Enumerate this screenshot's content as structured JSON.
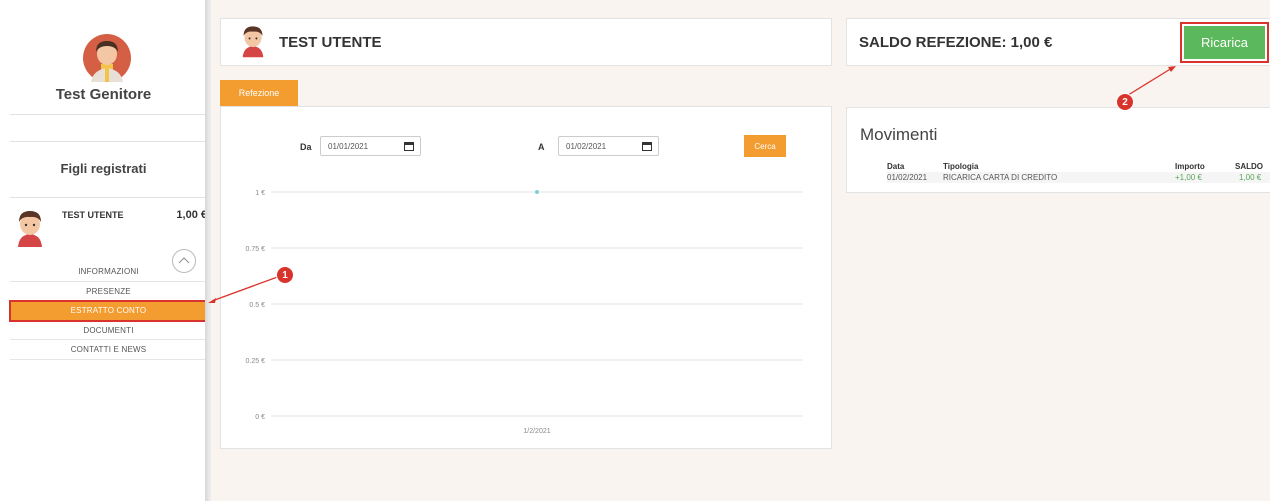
{
  "sidebar": {
    "parent_name": "Test Genitore",
    "children_title": "Figli registrati",
    "child": {
      "name": "TEST UTENTE",
      "balance": "1,00 €"
    },
    "menu": [
      {
        "label": "INFORMAZIONI",
        "active": false
      },
      {
        "label": "PRESENZE",
        "active": false
      },
      {
        "label": "ESTRATTO CONTO",
        "active": true
      },
      {
        "label": "DOCUMENTI",
        "active": false
      },
      {
        "label": "CONTATTI E NEWS",
        "active": false
      }
    ]
  },
  "header": {
    "user_title": "TEST UTENTE",
    "saldo_title": "SALDO REFEZIONE: 1,00 €",
    "ricarica_label": "Ricarica"
  },
  "tab": {
    "label": "Refezione"
  },
  "filter": {
    "from_label": "Da",
    "from_value": "01/01/2021",
    "to_label": "A",
    "to_value": "01/02/2021",
    "search_label": "Cerca"
  },
  "chart_data": {
    "type": "line",
    "title": "",
    "xlabel": "",
    "ylabel": "",
    "ylim": [
      0,
      1
    ],
    "y_ticks": [
      "0 €",
      "0.25 €",
      "0.5 €",
      "0.75 €",
      "1 €"
    ],
    "x_ticks": [
      "1/2/2021"
    ],
    "series": [
      {
        "x": [
          "1/2/2021"
        ],
        "values": [
          1
        ]
      }
    ],
    "grid": true
  },
  "movements": {
    "title": "Movimenti",
    "columns": [
      "Data",
      "Tipologia",
      "Importo",
      "SALDO"
    ],
    "rows": [
      {
        "date": "01/02/2021",
        "type": "RICARICA CARTA DI CREDITO",
        "amount": "+1,00 €",
        "balance": "1,00 €"
      }
    ]
  },
  "annotations": [
    "1",
    "2"
  ],
  "colors": {
    "accent_orange": "#f39c2f",
    "ricarica_green": "#5cb85c",
    "annotation_red": "#d9342c",
    "positive_amount": "#5aa55a",
    "chart_point": "#7ecfd4"
  }
}
